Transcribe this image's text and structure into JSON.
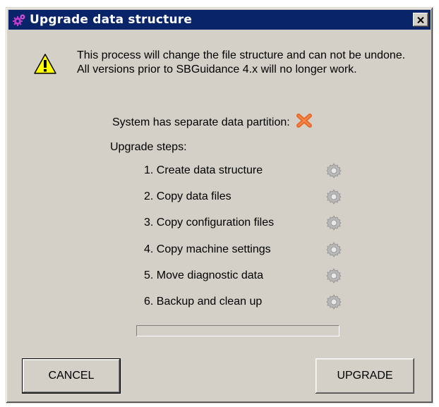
{
  "window": {
    "title": "Upgrade data structure",
    "title_icon": "gears-icon",
    "close_label": "close"
  },
  "message": "This process will change the file structure and can not be undone. All versions prior to SBGuidance 4.x will no longer work.",
  "partition": {
    "label": "System has separate data partition:",
    "status_icon": "red-x-icon"
  },
  "steps_heading": "Upgrade steps:",
  "steps": [
    {
      "label": "1. Create data structure",
      "status_icon": "gear-icon"
    },
    {
      "label": "2. Copy data files",
      "status_icon": "gear-icon"
    },
    {
      "label": "3. Copy configuration files",
      "status_icon": "gear-icon"
    },
    {
      "label": "4. Copy machine settings",
      "status_icon": "gear-icon"
    },
    {
      "label": "5. Move diagnostic data",
      "status_icon": "gear-icon"
    },
    {
      "label": "6. Backup and clean up",
      "status_icon": "gear-icon"
    }
  ],
  "progress": 0,
  "buttons": {
    "cancel": "CANCEL",
    "upgrade": "UPGRADE"
  },
  "colors": {
    "titlebar": "#0a246a",
    "dialog_bg": "#d4d0c8",
    "x_icon": "#e8682a"
  }
}
